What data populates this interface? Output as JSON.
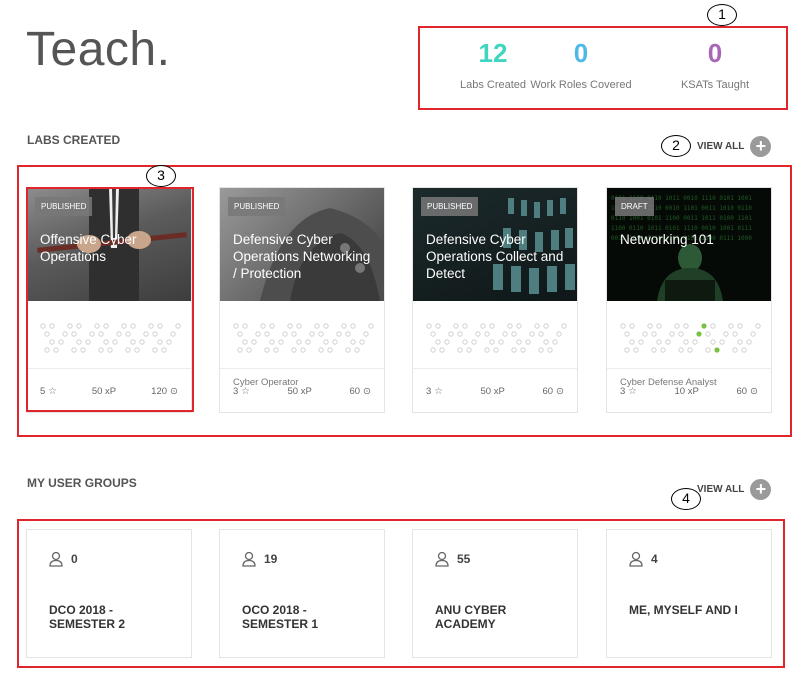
{
  "header": {
    "title": "Teach."
  },
  "stats": [
    {
      "value": "12",
      "label": "Labs Created",
      "color": "#3ed6c0"
    },
    {
      "value": "0",
      "label": "Work Roles Covered",
      "color": "#4fb8e8"
    },
    {
      "value": "0",
      "label": "KSATs Taught",
      "color": "#a965b8"
    }
  ],
  "labs_section": {
    "title": "LABS CREATED",
    "view_all": "VIEW ALL"
  },
  "labs": [
    {
      "status": "PUBLISHED",
      "name": "Offensive Cyber Operations",
      "role": "",
      "stars": "5",
      "xp": "50 xP",
      "time": "120",
      "image": "businessman-rope"
    },
    {
      "status": "PUBLISHED",
      "name": "Defensive Cyber Operations Networking / Protection",
      "role": "Cyber Operator",
      "stars": "3",
      "xp": "50 xP",
      "time": "60",
      "image": "armor"
    },
    {
      "status": "PUBLISHED",
      "name": "Defensive Cyber Operations Collect and Detect",
      "role": "",
      "stars": "3",
      "xp": "50 xP",
      "time": "60",
      "image": "chess-pieces"
    },
    {
      "status": "DRAFT",
      "name": "Networking 101",
      "role": "Cyber Defense Analyst",
      "stars": "3",
      "xp": "10 xP",
      "time": "60",
      "image": "hacker-matrix"
    }
  ],
  "groups_section": {
    "title": "MY USER GROUPS",
    "view_all": "VIEW ALL"
  },
  "groups": [
    {
      "count": "0",
      "name": "DCO 2018 - SEMESTER 2"
    },
    {
      "count": "19",
      "name": "OCO 2018 - SEMESTER 1"
    },
    {
      "count": "55",
      "name": "ANU CYBER ACADEMY"
    },
    {
      "count": "4",
      "name": "ME, MYSELF AND I"
    }
  ],
  "annotations": [
    "1",
    "2",
    "3",
    "4"
  ]
}
